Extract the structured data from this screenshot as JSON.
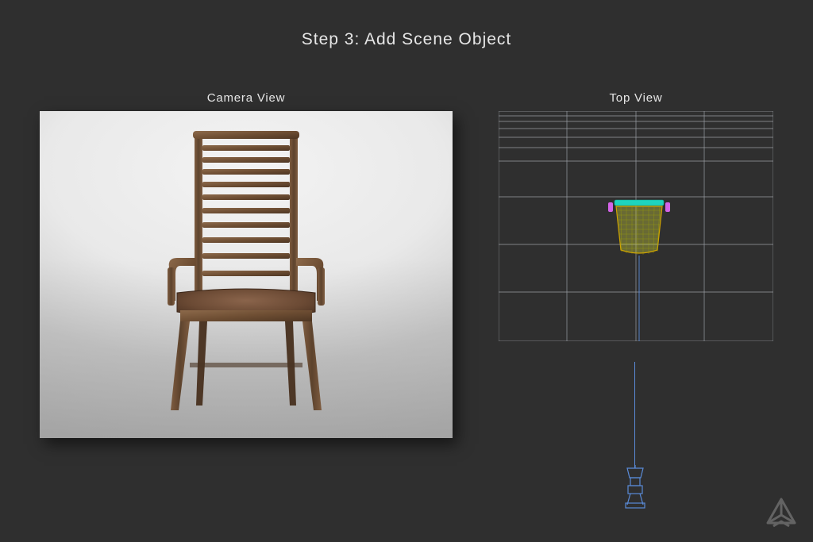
{
  "title": "Step 3: Add Scene Object",
  "panels": {
    "camera": {
      "label": "Camera View"
    },
    "top": {
      "label": "Top View"
    }
  }
}
